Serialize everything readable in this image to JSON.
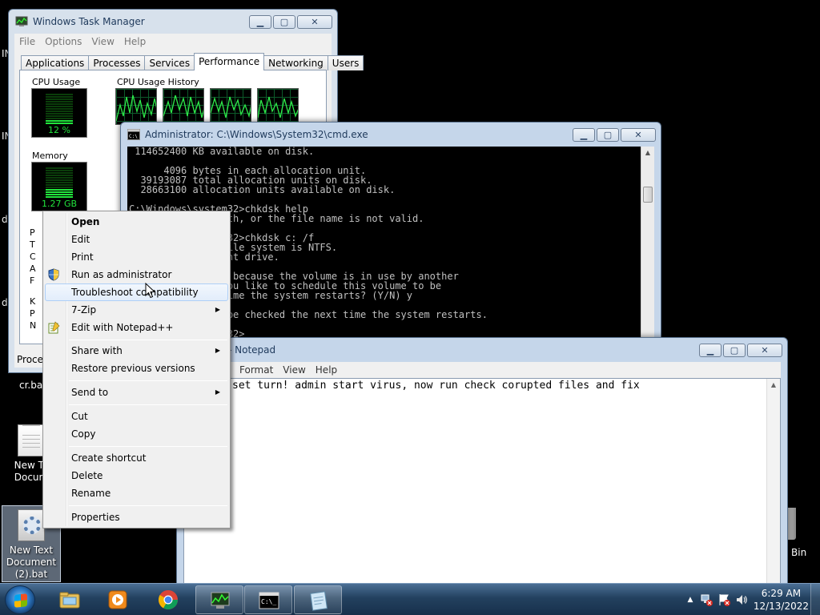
{
  "desktop": {
    "partial_labels": [
      "IN",
      "IN",
      "d",
      "d"
    ],
    "icons": [
      {
        "label": "cr.bat"
      },
      {
        "label_line1": "New Te",
        "label_line2": "Docum"
      },
      {
        "label_line1": "New Text",
        "label_line2": "Document",
        "label_line3": "(2).bat"
      },
      {
        "label": "Bin"
      }
    ]
  },
  "taskmgr": {
    "title": "Windows Task Manager",
    "menu": [
      "File",
      "Options",
      "View",
      "Help"
    ],
    "tabs": [
      "Applications",
      "Processes",
      "Services",
      "Performance",
      "Networking",
      "Users"
    ],
    "active_tab": "Performance",
    "cpu_usage_label": "CPU Usage",
    "cpu_history_label": "CPU Usage History",
    "cpu_value": "12 %",
    "cpu_fraction": 0.12,
    "memory_label": "Memory",
    "memory_value": "1.27 GB",
    "memory_fraction": 0.3,
    "left_letters": [
      "P",
      "T",
      "C",
      "A",
      "F",
      "K",
      "P",
      "N"
    ],
    "status": "Proces"
  },
  "cmd": {
    "title": "Administrator: C:\\Windows\\System32\\cmd.exe",
    "lines": [
      " 114652400 KB available on disk.",
      "",
      "      4096 bytes in each allocation unit.",
      "  39193087 total allocation units on disk.",
      "  28663100 allocation units available on disk.",
      "",
      "C:\\Windows\\system32>chkdsk help",
      "                ath, or the file name is not valid.",
      "",
      "                m32>chkdsk c: /f",
      "                file system is NTFS.",
      "                ent drive.",
      "",
      "                n because the volume is in use by another",
      "                you like to schedule this volume to be",
      "                time the system restarts? (Y/N) y",
      "",
      "                 be checked the next time the system restarts.",
      "",
      "                m32>"
    ]
  },
  "notepad": {
    "title": "- Notepad",
    "menu": [
      "Format",
      "View",
      "Help"
    ],
    "text": "set turn! admin start virus, now run check corupted files and fix"
  },
  "context_menu": {
    "items": [
      {
        "label": "Open",
        "bold": true
      },
      {
        "label": "Edit"
      },
      {
        "label": "Print"
      },
      {
        "label": "Run as administrator",
        "icon": "uac-shield-icon"
      },
      {
        "label": "Troubleshoot compatibility",
        "highlighted": true
      },
      {
        "label": "7-Zip",
        "submenu": true
      },
      {
        "label": "Edit with Notepad++",
        "icon": "notepadpp-icon"
      },
      {
        "label": "Share with",
        "submenu": true
      },
      {
        "label": "Restore previous versions"
      },
      {
        "label": "Send to",
        "submenu": true
      },
      {
        "label": "Cut"
      },
      {
        "label": "Copy"
      },
      {
        "label": "Create shortcut"
      },
      {
        "label": "Delete"
      },
      {
        "label": "Rename"
      },
      {
        "label": "Properties"
      }
    ]
  },
  "taskbar": {
    "pinned": [
      "windows-explorer-icon",
      "media-player-icon",
      "chrome-icon",
      "task-manager-icon",
      "cmd-icon",
      "notepad-icon"
    ],
    "time": "6:29 AM",
    "date": "12/13/2022"
  },
  "colors": {
    "meter_green": "#21e43c",
    "taskbar_top": "#4b6f95",
    "taskbar_bottom": "#17304b"
  }
}
